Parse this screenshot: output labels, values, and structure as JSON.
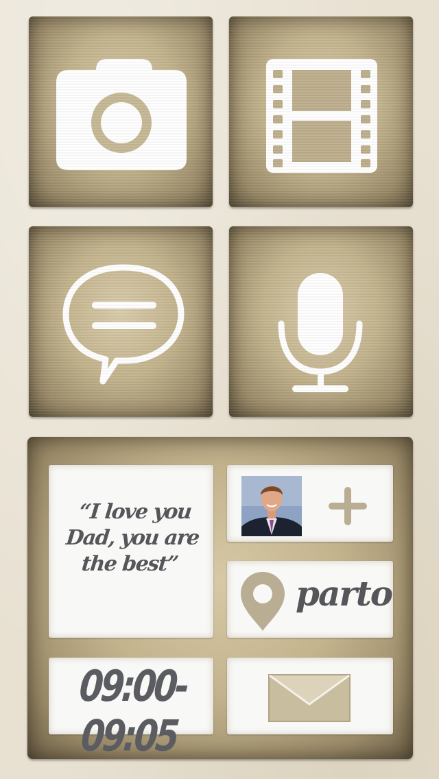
{
  "tiles": [
    {
      "name": "camera",
      "icon": "camera-icon"
    },
    {
      "name": "video",
      "icon": "film-icon"
    },
    {
      "name": "message",
      "icon": "chat-bubble-icon"
    },
    {
      "name": "voice",
      "icon": "microphone-icon"
    }
  ],
  "card": {
    "message_text": "“I love you Dad, you are the best”",
    "time_range": "09:00-09:05",
    "location": "parto",
    "contact_icon": "avatar",
    "add_icon": "plus-icon",
    "pin_icon": "location-pin-icon",
    "mail_icon": "envelope-icon"
  },
  "colors": {
    "background": "#e8e1d2",
    "tile": "#c3b38d",
    "card": "#f8f8f6",
    "text": "#55565a",
    "icon_white": "#ffffff",
    "icon_tan": "#b9ad93"
  }
}
